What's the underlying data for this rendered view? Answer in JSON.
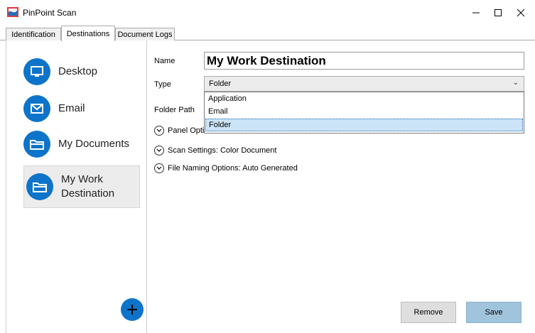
{
  "window": {
    "title": "PinPoint Scan"
  },
  "tabs": [
    {
      "label": "Identification"
    },
    {
      "label": "Destinations"
    },
    {
      "label": "Document Logs"
    }
  ],
  "destinations": [
    {
      "label": "Desktop",
      "icon": "monitor-icon"
    },
    {
      "label": "Email",
      "icon": "envelope-icon"
    },
    {
      "label": "My Documents",
      "icon": "folder-icon"
    },
    {
      "label": "My Work Destination",
      "icon": "folder-icon"
    }
  ],
  "form": {
    "name_label": "Name",
    "name_value": "My Work Destination",
    "type_label": "Type",
    "type_value": "Folder",
    "type_options": [
      "Application",
      "Email",
      "Folder"
    ],
    "folder_path_label": "Folder Path",
    "panel_options": "Panel Opti",
    "scan_settings": "Scan Settings: Color Document",
    "file_naming": "File Naming Options: Auto Generated"
  },
  "buttons": {
    "remove": "Remove",
    "save": "Save"
  },
  "colors": {
    "accent": "#0e74c9",
    "save_button": "#9fc4dc",
    "selection": "#cce4f7"
  }
}
